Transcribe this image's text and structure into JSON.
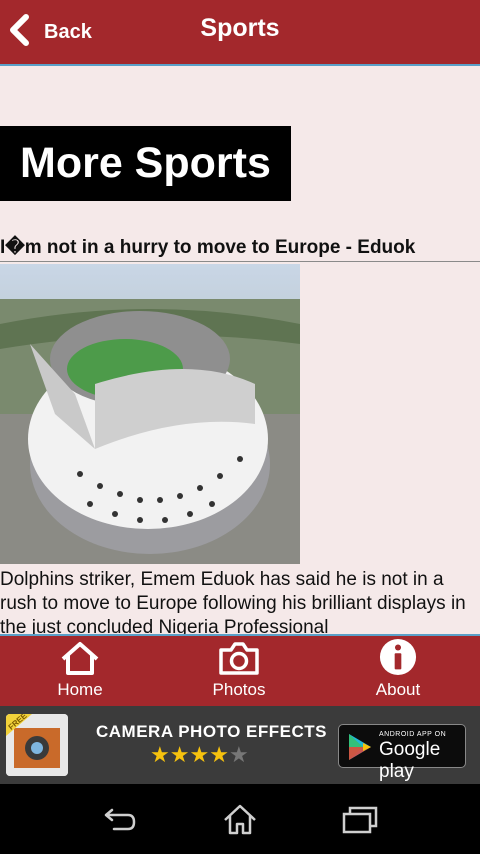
{
  "header": {
    "back_label": "Back",
    "title": "Sports"
  },
  "content": {
    "section_title": "More Sports",
    "article": {
      "headline": "I�m not in a hurry to move to Europe - Eduok",
      "body": "Dolphins striker, Emem Eduok has said he is not in a rush to move to Europe following his brilliant displays in the just concluded Nigeria Professional"
    }
  },
  "tabs": [
    {
      "label": "Home",
      "icon": "home-icon"
    },
    {
      "label": "Photos",
      "icon": "camera-icon"
    },
    {
      "label": "About",
      "icon": "info-icon"
    }
  ],
  "ad": {
    "title": "CAMERA PHOTO EFFECTS",
    "rating": 4,
    "badge": "FREE",
    "store_small": "ANDROID APP ON",
    "store_name": "Google play"
  },
  "colors": {
    "header_bg": "#a3282c",
    "accent": "#5aa0c8",
    "content_bg": "#f5e9e9"
  }
}
